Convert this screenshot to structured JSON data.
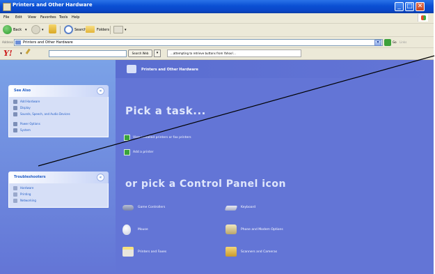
{
  "window": {
    "title": "Printers and Other Hardware"
  },
  "menu": [
    "File",
    "Edit",
    "View",
    "Favorites",
    "Tools",
    "Help"
  ],
  "toolbar": {
    "back": "Back",
    "search": "Search",
    "folders": "Folders"
  },
  "address": {
    "label": "Address",
    "value": "Printers and Other Hardware",
    "go": "Go",
    "links": "Links"
  },
  "yahoo": {
    "search_value": "",
    "search_button": "Search Web",
    "status": "...attempting to retrieve buttons from Yahoo!..."
  },
  "see_also": {
    "title": "See Also",
    "items": [
      "Add Hardware",
      "Display",
      "Sounds, Speech, and Audio Devices",
      "Power Options",
      "System"
    ]
  },
  "troubleshooters": {
    "title": "Troubleshooters",
    "items": [
      "Hardware",
      "Printing",
      "Networking"
    ]
  },
  "main": {
    "header": "Printers and Other Hardware",
    "pick_task": "Pick a task...",
    "tasks": [
      "View installed printers or fax printers",
      "Add a printer"
    ],
    "pick_icon": "or pick a Control Panel icon",
    "icons": [
      {
        "label": "Game Controllers",
        "icon": "gamepad-icon"
      },
      {
        "label": "Keyboard",
        "icon": "keyboard-icon"
      },
      {
        "label": "Mouse",
        "icon": "mouse-icon"
      },
      {
        "label": "Phone and Modem Options",
        "icon": "phone-icon"
      },
      {
        "label": "Printers and Faxes",
        "icon": "printer-icon"
      },
      {
        "label": "Scanners and Cameras",
        "icon": "scanner-icon"
      }
    ]
  },
  "colors": {
    "title_bar": "#0a4fd3",
    "content_bg": "#6375d6",
    "link": "#215dc6",
    "panel_bg": "#d6dff7"
  }
}
